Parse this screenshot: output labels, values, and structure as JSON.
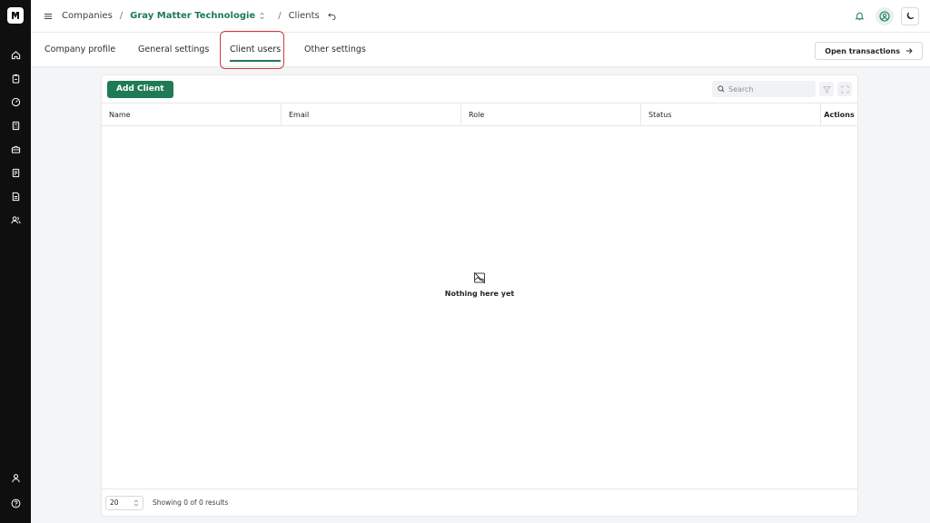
{
  "breadcrumb": {
    "menu_icon": "hamburger-icon",
    "items": [
      "Companies",
      "Gray Matter Technologie",
      "Clients"
    ],
    "separator": "/"
  },
  "tabs": [
    {
      "label": "Company profile",
      "active": false
    },
    {
      "label": "General settings",
      "active": false
    },
    {
      "label": "Client users",
      "active": true
    },
    {
      "label": "Other settings",
      "active": false
    }
  ],
  "open_transactions": {
    "label": "Open transactions",
    "icon": "arrow-right-icon"
  },
  "toolbar": {
    "add_label": "Add Client",
    "search_placeholder": "Search"
  },
  "table": {
    "columns": [
      "Name",
      "Email",
      "Role",
      "Status",
      "Actions"
    ]
  },
  "empty_state": {
    "text": "Nothing here yet",
    "icon": "no-image-icon"
  },
  "footer": {
    "page_size": "20",
    "results_text": "Showing 0 of 0 results"
  },
  "colors": {
    "accent": "#1f7a55",
    "sidebar": "#0f0f10",
    "highlight": "#d13a3a"
  },
  "sidebar": {
    "icons": [
      "home-icon",
      "clipboard-icon",
      "gauge-icon",
      "calculator-icon",
      "briefcase-icon",
      "document-icon",
      "file-text-icon",
      "users-icon"
    ],
    "bottom_icons": [
      "user-icon",
      "help-icon"
    ]
  }
}
